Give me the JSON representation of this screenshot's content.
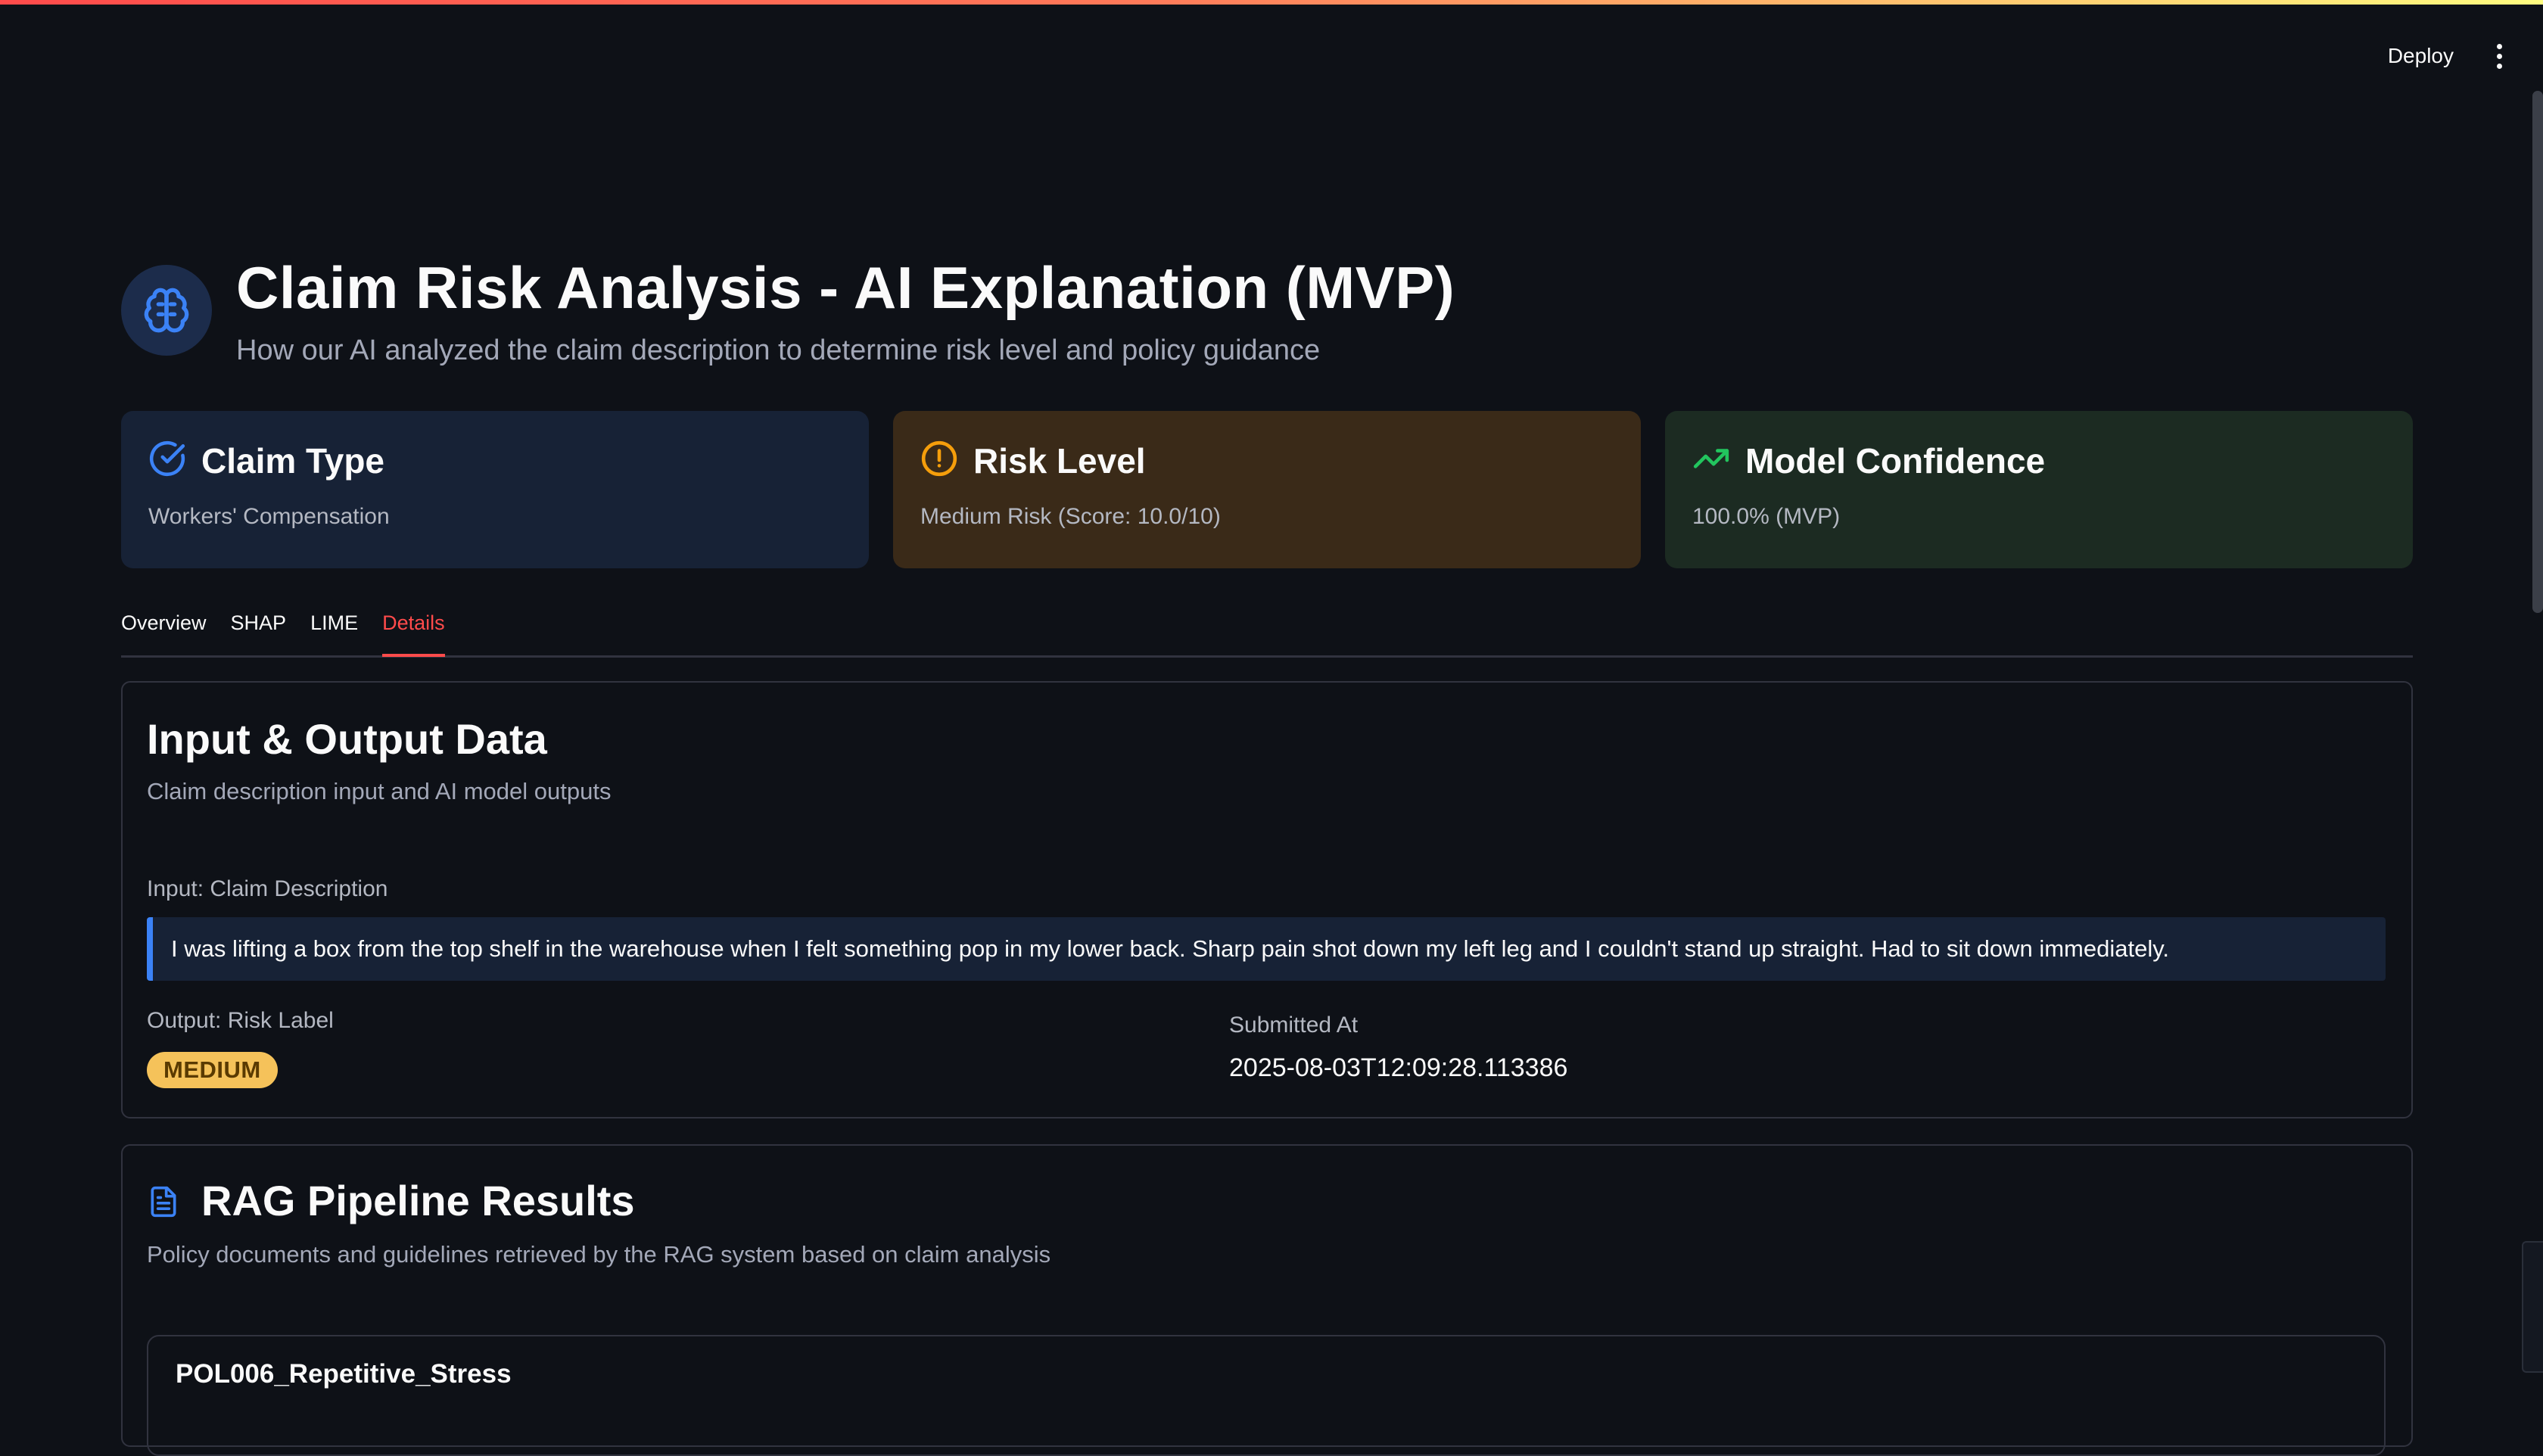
{
  "toolbar": {
    "deploy_label": "Deploy"
  },
  "header": {
    "title": "Claim Risk Analysis - AI Explanation (MVP)",
    "subtitle": "How our AI analyzed the claim description to determine risk level and policy guidance"
  },
  "cards": [
    {
      "title": "Claim Type",
      "value": "Workers' Compensation",
      "icon": "check-circle-icon",
      "color": "#3b82f6"
    },
    {
      "title": "Risk Level",
      "value": "Medium Risk (Score: 10.0/10)",
      "icon": "alert-circle-icon",
      "color": "#f59e0b"
    },
    {
      "title": "Model Confidence",
      "value": "100.0% (MVP)",
      "icon": "trending-up-icon",
      "color": "#22c55e"
    }
  ],
  "tabs": [
    {
      "label": "Overview"
    },
    {
      "label": "SHAP"
    },
    {
      "label": "LIME"
    },
    {
      "label": "Details",
      "active": true
    }
  ],
  "details": {
    "title": "Input & Output Data",
    "subtitle": "Claim description input and AI model outputs",
    "input_label": "Input: Claim Description",
    "input_text": "I was lifting a box from the top shelf in the warehouse when I felt something pop in my lower back. Sharp pain shot down my left leg and I couldn't stand up straight. Had to sit down immediately.",
    "output_label": "Output: Risk Label",
    "risk_badge": "MEDIUM",
    "submitted_label": "Submitted At",
    "submitted_value": "2025-08-03T12:09:28.113386"
  },
  "rag": {
    "title": "RAG Pipeline Results",
    "subtitle": "Policy documents and guidelines retrieved by the RAG system based on claim analysis",
    "documents": [
      {
        "title": "POL006_Repetitive_Stress"
      }
    ]
  },
  "colors": {
    "accent": "#ff4b4b",
    "background": "#0e1117",
    "badge": "#f5c25a"
  }
}
